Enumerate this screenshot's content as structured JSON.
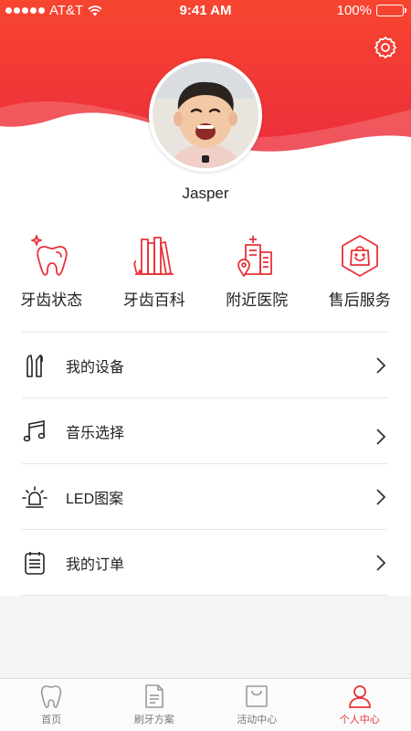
{
  "status_bar": {
    "carrier": "AT&T",
    "time": "9:41 AM",
    "battery": "100%"
  },
  "profile": {
    "username": "Jasper"
  },
  "quick_actions": [
    {
      "label": "牙齿状态",
      "icon": "tooth-sparkle-icon"
    },
    {
      "label": "牙齿百科",
      "icon": "tooth-books-icon"
    },
    {
      "label": "附近医院",
      "icon": "hospital-location-icon"
    },
    {
      "label": "售后服务",
      "icon": "shopping-bag-smile-icon"
    }
  ],
  "menu": [
    {
      "label": "我的设备",
      "icon": "toothbrush-icon"
    },
    {
      "label": "音乐选择",
      "icon": "music-note-icon"
    },
    {
      "label": "LED图案",
      "icon": "led-bulb-icon"
    },
    {
      "label": "我的订单",
      "icon": "order-list-icon"
    }
  ],
  "tabbar": [
    {
      "label": "首页",
      "icon": "tooth-home-icon",
      "active": false
    },
    {
      "label": "刷牙方案",
      "icon": "document-icon",
      "active": false
    },
    {
      "label": "活动中心",
      "icon": "bag-icon",
      "active": false
    },
    {
      "label": "个人中心",
      "icon": "person-icon",
      "active": true
    }
  ],
  "colors": {
    "accent": "#e8333a",
    "header_top": "#f24a3d",
    "header_bottom": "#ee2f3b"
  }
}
